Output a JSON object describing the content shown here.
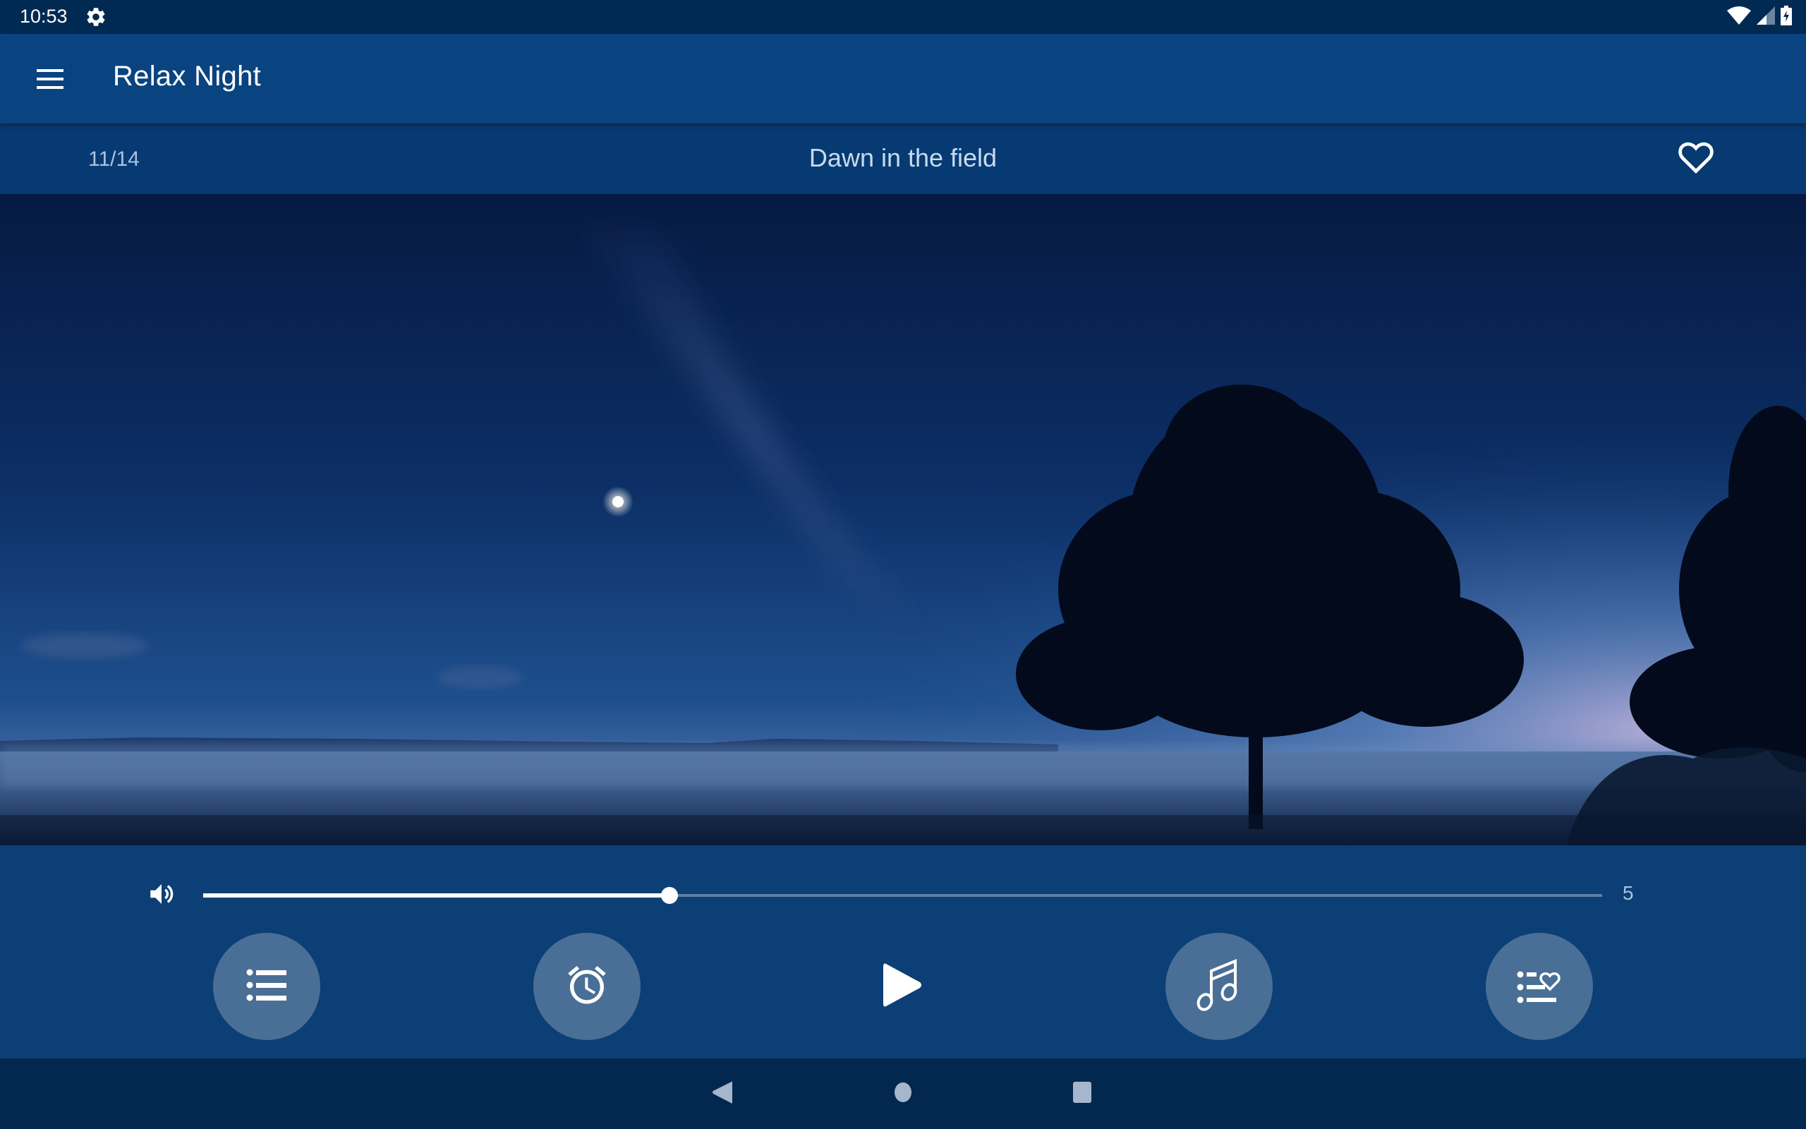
{
  "status_bar": {
    "time": "10:53",
    "left_icons": [
      "settings-gear-icon"
    ],
    "right_icons": [
      "wifi-icon",
      "cell-signal-icon",
      "battery-charging-icon"
    ]
  },
  "app_bar": {
    "menu_icon": "hamburger-menu-icon",
    "title": "Relax Night"
  },
  "now_playing": {
    "counter": "11/14",
    "current_index": 11,
    "total": 14,
    "title": "Dawn in the field",
    "favorite_icon": "heart-outline-icon",
    "is_favorite": false
  },
  "scene": {
    "description": "Night sky over a misty field with a moon and silhouetted trees",
    "colors": {
      "sky_top": "#061a42",
      "sky_mid": "#0e3a78",
      "horizon": "#4a78b8",
      "glow": "#b8a8d8",
      "mist": "#5c7fae",
      "ground": "#0f2240",
      "tree": "#020818"
    }
  },
  "volume": {
    "icon": "speaker-volume-icon",
    "value": 5,
    "max": 15,
    "fraction": 0.333,
    "label": "5"
  },
  "controls": {
    "playlist": {
      "icon": "list-icon",
      "label": "Playlist"
    },
    "timer": {
      "icon": "alarm-clock-icon",
      "label": "Sleep timer"
    },
    "play": {
      "icon": "play-icon",
      "label": "Play"
    },
    "sounds": {
      "icon": "music-note-icon",
      "label": "Sounds"
    },
    "favorites": {
      "icon": "favorites-list-icon",
      "label": "Favorites"
    }
  },
  "nav_bar": {
    "back_icon": "back-triangle-icon",
    "home_icon": "home-circle-icon",
    "recents_icon": "recents-square-icon"
  },
  "colors": {
    "status_bar_bg": "#012a52",
    "app_bar_bg": "#0a4480",
    "sub_header_bg": "#073a72",
    "controls_bg": "#0b3f75",
    "nav_bar_bg": "#03284f",
    "button_circle": "#4a6f96",
    "muted_text": "#a8c2e0",
    "title_text": "#c8daf0",
    "accent": "#ffffff"
  }
}
